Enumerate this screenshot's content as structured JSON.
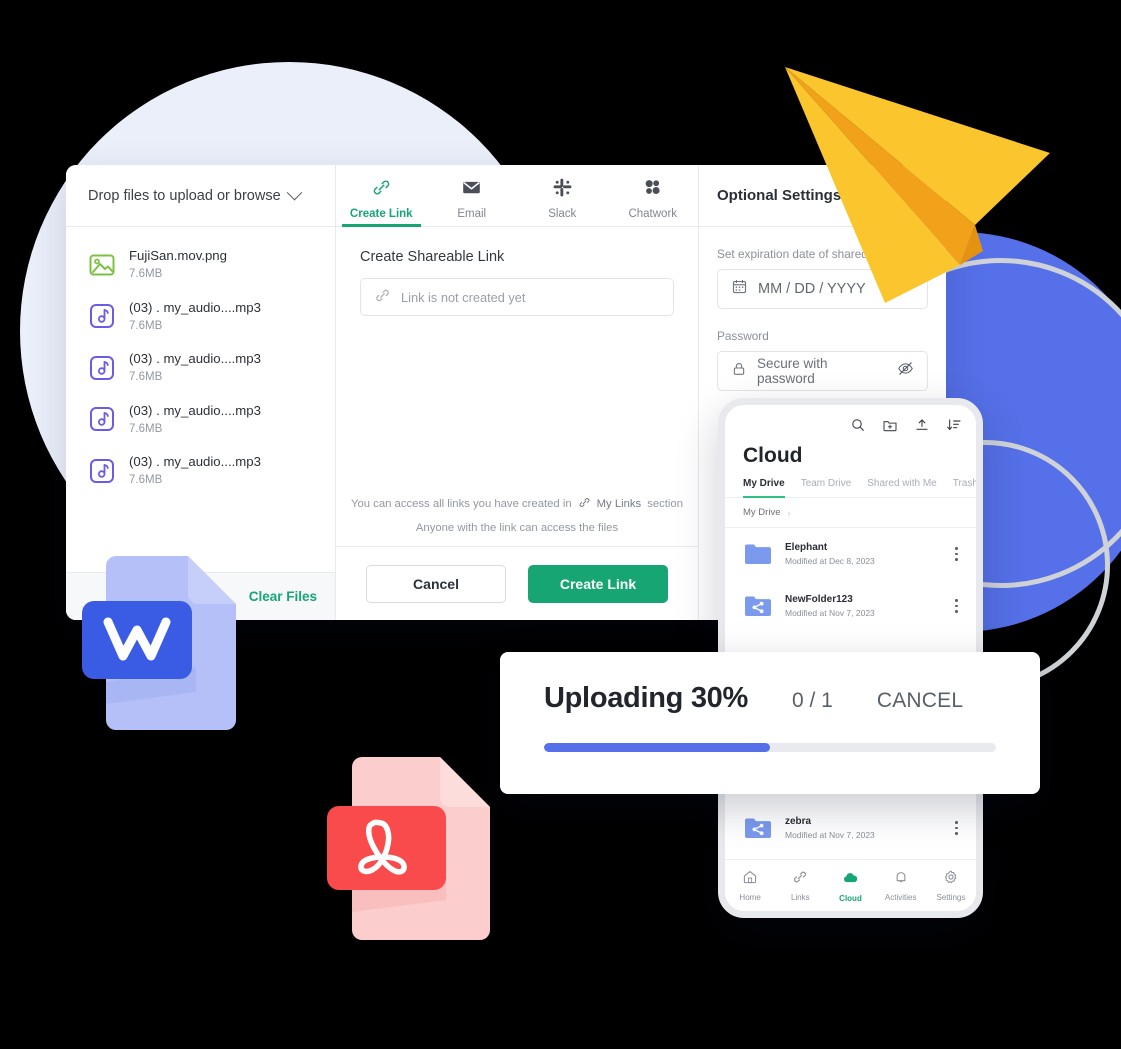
{
  "share_dialog": {
    "files_panel": {
      "header_label": "Drop files to upload or browse",
      "dropdown_icon": "chevron-down-icon",
      "clear_files_label": "Clear Files",
      "files": [
        {
          "name": "FujiSan.mov.png",
          "size": "7.6MB",
          "icon": "image-file-icon",
          "icon_color": "#7CC142"
        },
        {
          "name": "(03) . my_audio....mp3",
          "size": "7.6MB",
          "icon": "audio-file-icon",
          "icon_color": "#6B5CE7"
        },
        {
          "name": "(03) . my_audio....mp3",
          "size": "7.6MB",
          "icon": "audio-file-icon",
          "icon_color": "#6B5CE7"
        },
        {
          "name": "(03) . my_audio....mp3",
          "size": "7.6MB",
          "icon": "audio-file-icon",
          "icon_color": "#6B5CE7"
        },
        {
          "name": "(03) . my_audio....mp3",
          "size": "7.6MB",
          "icon": "audio-file-icon",
          "icon_color": "#6B5CE7"
        }
      ]
    },
    "tabs": [
      {
        "label": "Create Link",
        "icon": "link-icon",
        "active": true
      },
      {
        "label": "Email",
        "icon": "envelope-icon",
        "active": false
      },
      {
        "label": "Slack",
        "icon": "slack-icon",
        "active": false
      },
      {
        "label": "Chatwork",
        "icon": "chatwork-icon",
        "active": false
      }
    ],
    "share_panel": {
      "section_title": "Create Shareable Link",
      "link_placeholder": "Link is not created yet",
      "note_prefix": "You can access all links you have created in",
      "note_link_label": "My Links",
      "note_suffix": "section",
      "note_secondary": "Anyone with the link can access the files",
      "cancel_label": "Cancel",
      "create_label": "Create Link"
    },
    "optional_settings": {
      "title": "Optional Settings",
      "expiration_label": "Set expiration date of shared link",
      "expiration_placeholder": "MM / DD / YYYY",
      "calendar_icon": "calendar-icon",
      "password_label": "Password",
      "password_placeholder": "Secure with password",
      "lock_icon": "lock-icon",
      "toggle_visibility_icon": "eye-off-icon"
    }
  },
  "phone": {
    "toolbar_icons": [
      "search-icon",
      "new-folder-icon",
      "upload-icon",
      "sort-icon"
    ],
    "title": "Cloud",
    "tabs": [
      {
        "label": "My Drive",
        "active": true
      },
      {
        "label": "Team Drive",
        "active": false
      },
      {
        "label": "Shared with Me",
        "active": false
      },
      {
        "label": "Trash",
        "active": false
      }
    ],
    "breadcrumb": {
      "label": "My Drive",
      "separator": "›"
    },
    "items": [
      {
        "name": "Elephant",
        "modified": "Modified at Dec 8, 2023",
        "icon": "folder-icon",
        "menu_icon": "kebab-menu-icon"
      },
      {
        "name": "NewFolder123",
        "modified": "Modified at Nov 7, 2023",
        "icon": "shared-folder-icon",
        "menu_icon": "kebab-menu-icon"
      },
      {
        "name": "zebra",
        "modified": "Modified at Nov 7, 2023",
        "icon": "shared-folder-icon",
        "menu_icon": "kebab-menu-icon"
      }
    ],
    "bottom_nav": [
      {
        "label": "Home",
        "icon": "home-icon",
        "active": false
      },
      {
        "label": "Links",
        "icon": "link-icon",
        "active": false
      },
      {
        "label": "Cloud",
        "icon": "cloud-icon",
        "active": true
      },
      {
        "label": "Activities",
        "icon": "bell-icon",
        "active": false
      },
      {
        "label": "Settings",
        "icon": "gear-icon",
        "active": false
      }
    ]
  },
  "upload_toast": {
    "status": "Uploading 30%",
    "count": "0 / 1",
    "cancel_label": "CANCEL",
    "progress_percent": 50
  },
  "decorations": {
    "paper_plane": "paper-plane-illustration",
    "word_doc": "word-document-icon",
    "pdf_doc": "pdf-document-icon",
    "colors": {
      "accent_green": "#17A673",
      "accent_blue": "#5570E8",
      "lavender": "#EBEFFA",
      "yellow": "#FBC52D",
      "yellow_dark": "#F2A21A",
      "pdf_red": "#F94B4B",
      "word_blue": "#3A5CE5"
    }
  }
}
